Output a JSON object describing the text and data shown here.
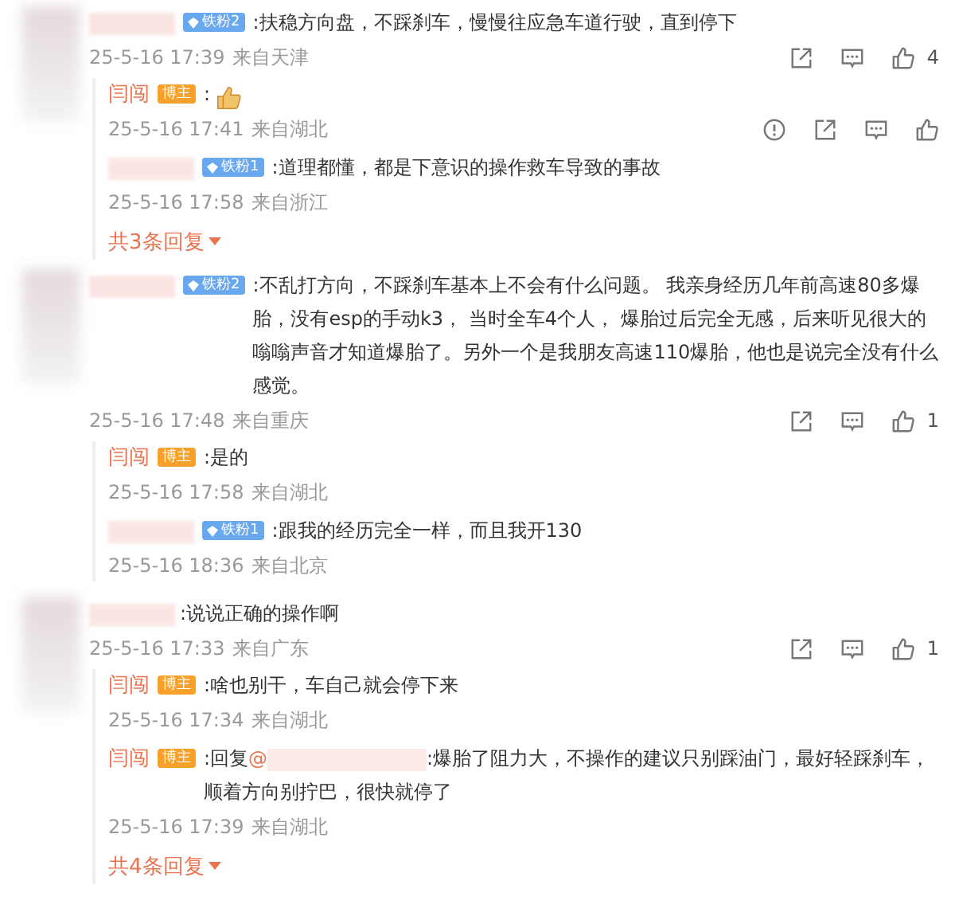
{
  "comments": [
    {
      "badge": {
        "kind": "fan",
        "label": "铁粉2"
      },
      "text": ":扶稳方向盘，不踩刹车，慢慢往应急车道行驶，直到停下",
      "time": "25-5-16 17:39",
      "location": "来自天津",
      "likes": "4",
      "replies": [
        {
          "author": "闫闯",
          "badge": {
            "kind": "host",
            "label": "博主"
          },
          "text": ":",
          "sticker": true,
          "time": "25-5-16 17:41",
          "location": "来自湖北",
          "actions_shown": true
        },
        {
          "badge": {
            "kind": "fan",
            "label": "铁粉1"
          },
          "text": ":道理都懂，都是下意识的操作救车导致的事故",
          "time": "25-5-16 17:58",
          "location": "来自浙江",
          "actions_shown": false
        }
      ],
      "more_replies": "共3条回复"
    },
    {
      "badge": {
        "kind": "fan",
        "label": "铁粉2"
      },
      "text": ":不乱打方向，不踩刹车基本上不会有什么问题。 我亲身经历几年前高速80多爆胎，没有esp的手动k3， 当时全车4个人， 爆胎过后完全无感，后来听见很大的嗡嗡声音才知道爆胎了。另外一个是我朋友高速110爆胎，他也是说完全没有什么感觉。",
      "time": "25-5-16 17:48",
      "location": "来自重庆",
      "likes": "1",
      "replies": [
        {
          "author": "闫闯",
          "badge": {
            "kind": "host",
            "label": "博主"
          },
          "text": ":是的",
          "time": "25-5-16 17:58",
          "location": "来自湖北",
          "actions_shown": false
        },
        {
          "badge": {
            "kind": "fan",
            "label": "铁粉1"
          },
          "text": ":跟我的经历完全一样，而且我开130",
          "time": "25-5-16 18:36",
          "location": "来自北京",
          "actions_shown": false
        }
      ]
    },
    {
      "text": ":说说正确的操作啊",
      "time": "25-5-16 17:33",
      "location": "来自广东",
      "likes": "1",
      "replies": [
        {
          "author": "闫闯",
          "badge": {
            "kind": "host",
            "label": "博主"
          },
          "text": ":啥也别干，车自己就会停下来",
          "time": "25-5-16 17:34",
          "location": "来自湖北",
          "actions_shown": false
        },
        {
          "author": "闫闯",
          "badge": {
            "kind": "host",
            "label": "博主"
          },
          "text": ":回复",
          "mention": "@",
          "text_after": ":爆胎了阻力大，不操作的建议只别踩油门，最好轻踩刹车，顺着方向别拧巴，很快就停了",
          "time": "25-5-16 17:39",
          "location": "来自湖北",
          "actions_shown": false
        }
      ],
      "more_replies": "共4条回复"
    }
  ]
}
